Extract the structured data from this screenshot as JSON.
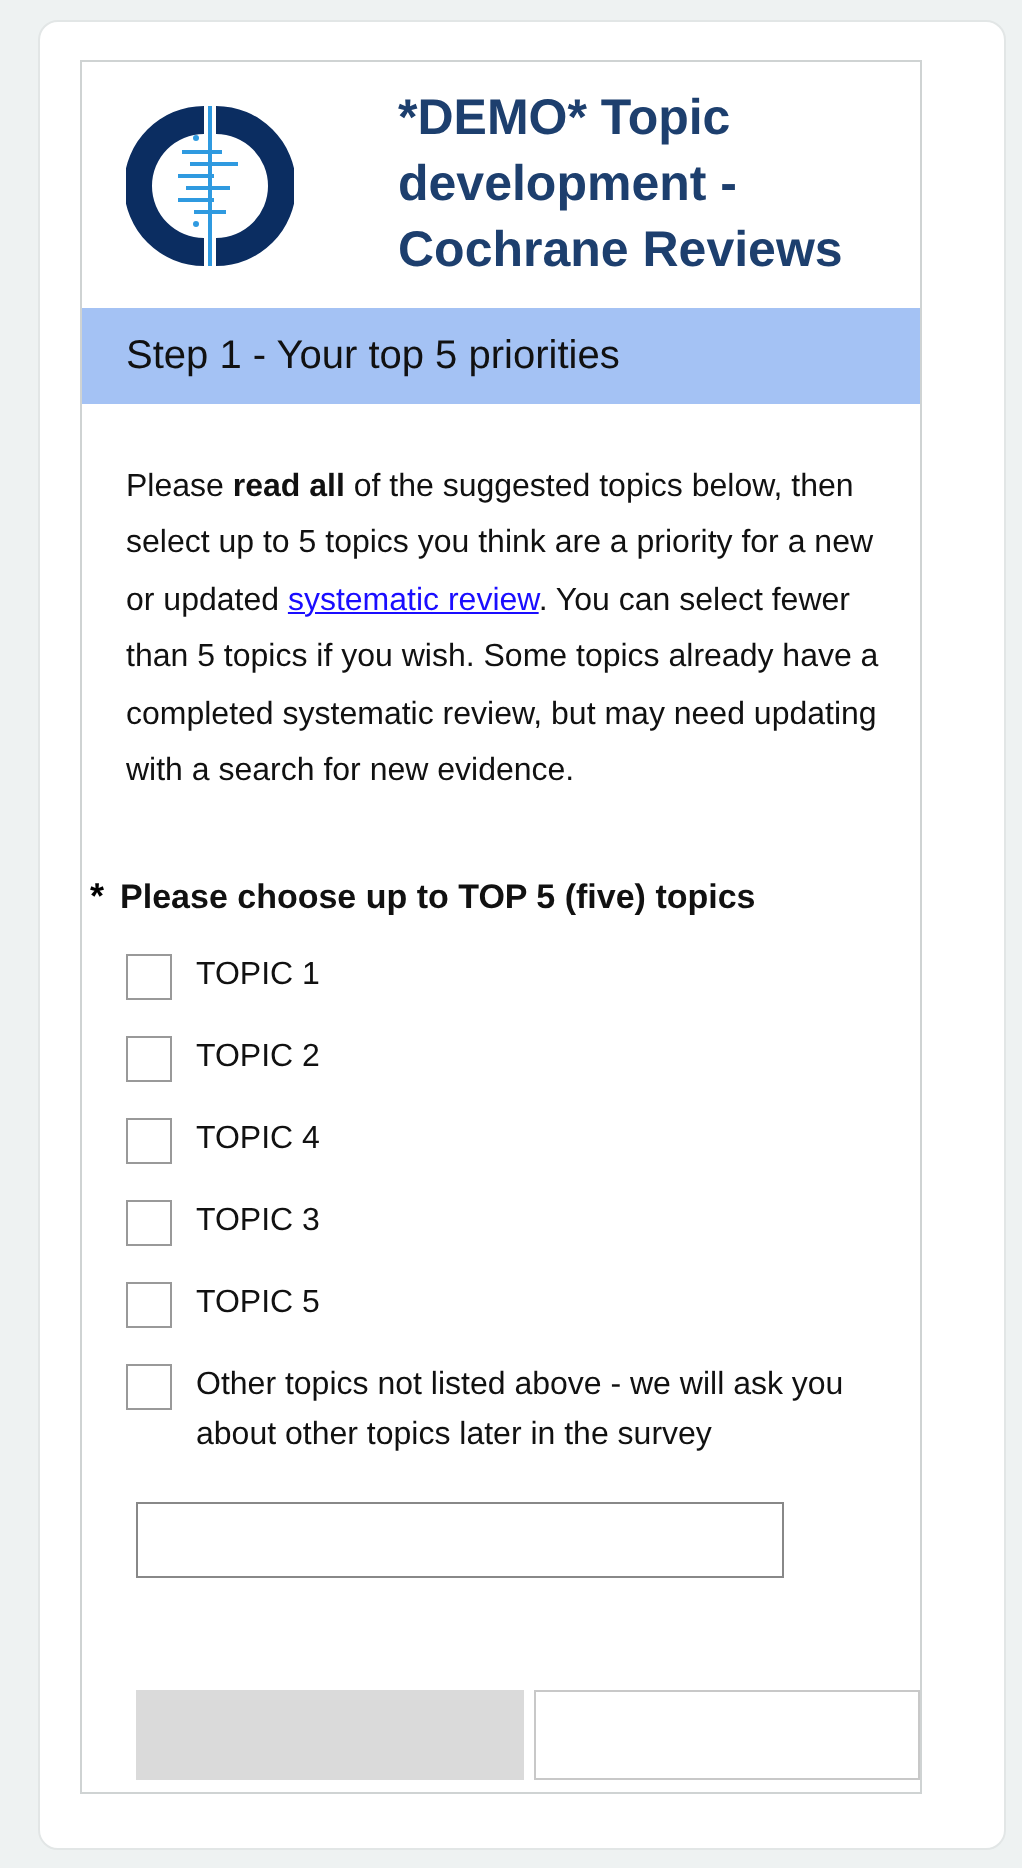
{
  "header": {
    "title": "*DEMO* Topic development - Cochrane Reviews"
  },
  "step": {
    "title": "Step 1 - Your top 5 priorities"
  },
  "intro": {
    "before": "Please **read all** of the suggested topics below, then select up to 5 topics you think are a priority for a new or updated ",
    "link": "systematic review",
    "after": ". You can select fewer than 5 topics if you wish. Some topics already have a completed systematic review, but may need updating with a search for new evidence."
  },
  "question": {
    "required_mark": "*",
    "label": "Please choose up to TOP 5 (five) topics",
    "options": [
      {
        "label": "TOPIC 1",
        "checked": false
      },
      {
        "label": "TOPIC 2",
        "checked": false
      },
      {
        "label": "TOPIC 4",
        "checked": false
      },
      {
        "label": "TOPIC 3",
        "checked": false
      },
      {
        "label": "TOPIC 5",
        "checked": false
      },
      {
        "label": "Other topics not listed above - we will ask you about other topics later in the survey",
        "checked": false
      }
    ]
  },
  "nav_buttons": [
    {
      "kind": "back"
    },
    {
      "kind": "next"
    }
  ]
}
